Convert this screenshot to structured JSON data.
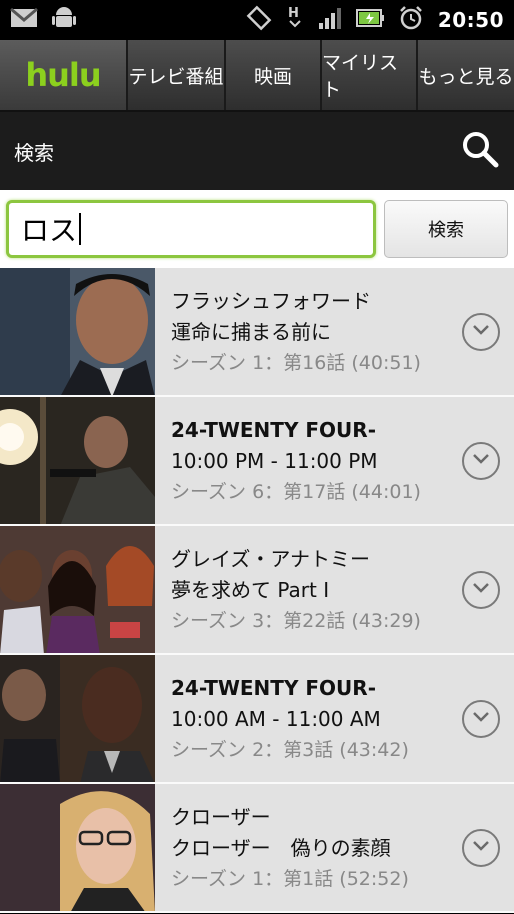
{
  "status_bar": {
    "time": "20:50",
    "icons": [
      "gmail-icon",
      "android-icon",
      "rotate-icon",
      "signal-h-icon",
      "signal-bars-icon",
      "battery-icon",
      "alarm-icon"
    ]
  },
  "nav": {
    "logo": "hulu",
    "tabs": [
      {
        "label": "テレビ番組"
      },
      {
        "label": "映画"
      },
      {
        "label": "マイリスト"
      },
      {
        "label": "もっと見る"
      }
    ]
  },
  "search_header": {
    "title": "検索"
  },
  "search": {
    "value": "ロス",
    "button_label": "検索"
  },
  "accent_color": "#8cc63f",
  "results": [
    {
      "title1": "フラッシュフォワード",
      "title2": "運命に捕まる前に",
      "meta": "シーズン 1：第16話 (40:51)",
      "bold": false
    },
    {
      "title1": "24-TWENTY FOUR-",
      "title2": "10:00 PM - 11:00 PM",
      "meta": "シーズン 6：第17話 (44:01)",
      "bold": true
    },
    {
      "title1": "グレイズ・アナトミー",
      "title2": "夢を求めて Part I",
      "meta": "シーズン 3：第22話 (43:29)",
      "bold": false
    },
    {
      "title1": "24-TWENTY FOUR-",
      "title2": "10:00 AM - 11:00 AM",
      "meta": "シーズン 2：第3話 (43:42)",
      "bold": true
    },
    {
      "title1": "クローザー",
      "title2": "クローザー　偽りの素顔",
      "meta": "シーズン 1：第1話 (52:52)",
      "bold": false
    }
  ]
}
